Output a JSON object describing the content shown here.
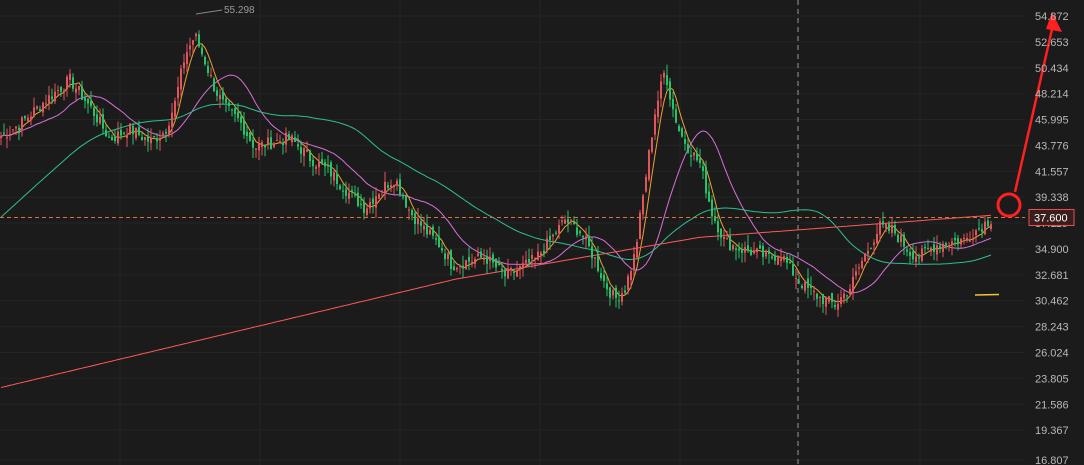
{
  "chart_data": {
    "type": "candlestick",
    "y_axis": {
      "ticks": [
        "54.872",
        "52.653",
        "50.434",
        "48.214",
        "45.995",
        "43.776",
        "41.557",
        "39.338",
        "37.119",
        "34.900",
        "32.681",
        "30.462",
        "28.243",
        "26.024",
        "23.805",
        "21.586",
        "19.367",
        "16.807"
      ],
      "range": [
        16.807,
        56.2
      ]
    },
    "current_price": {
      "label": "37.600",
      "value": 37.6
    },
    "peak_label": {
      "text": "55.298",
      "value": 55.298
    },
    "grid": true,
    "colors": {
      "background": "#1b1b1b",
      "up": "#e0565c",
      "down": "#23c56b",
      "ma_short": "#f0a030",
      "ma_mid": "#d870d8",
      "ma_long": "#2fbf8f",
      "ma_longest": "#ff5a5a",
      "annotation": "#ff2020",
      "price_tag": "#e85050"
    },
    "anchors": [
      [
        0,
        44.5
      ],
      [
        20,
        45.6
      ],
      [
        45,
        47.6
      ],
      [
        70,
        49.4
      ],
      [
        90,
        47.1
      ],
      [
        110,
        44.3
      ],
      [
        130,
        45.2
      ],
      [
        150,
        44.1
      ],
      [
        165,
        45.0
      ],
      [
        175,
        47.4
      ],
      [
        185,
        51.5
      ],
      [
        195,
        53.2
      ],
      [
        205,
        51.0
      ],
      [
        215,
        48.6
      ],
      [
        225,
        47.0
      ],
      [
        240,
        45.8
      ],
      [
        255,
        43.6
      ],
      [
        270,
        44.0
      ],
      [
        290,
        44.4
      ],
      [
        310,
        42.7
      ],
      [
        330,
        41.5
      ],
      [
        350,
        39.6
      ],
      [
        365,
        38.4
      ],
      [
        380,
        40.0
      ],
      [
        395,
        41.0
      ],
      [
        410,
        38.1
      ],
      [
        425,
        36.5
      ],
      [
        440,
        35.2
      ],
      [
        452,
        33.5
      ],
      [
        465,
        33.8
      ],
      [
        485,
        34.2
      ],
      [
        505,
        32.6
      ],
      [
        520,
        33.2
      ],
      [
        535,
        34.0
      ],
      [
        550,
        35.6
      ],
      [
        565,
        37.4
      ],
      [
        580,
        36.4
      ],
      [
        595,
        34.0
      ],
      [
        605,
        31.9
      ],
      [
        615,
        30.6
      ],
      [
        625,
        31.5
      ],
      [
        635,
        34.5
      ],
      [
        645,
        40.6
      ],
      [
        655,
        46.6
      ],
      [
        665,
        50.3
      ],
      [
        672,
        47.2
      ],
      [
        680,
        44.8
      ],
      [
        690,
        43.4
      ],
      [
        700,
        42.2
      ],
      [
        712,
        38.0
      ],
      [
        725,
        35.5
      ],
      [
        740,
        34.9
      ],
      [
        755,
        34.6
      ],
      [
        770,
        34.1
      ],
      [
        780,
        34.6
      ],
      [
        790,
        33.2
      ],
      [
        805,
        31.6
      ],
      [
        820,
        30.7
      ],
      [
        835,
        30.1
      ],
      [
        850,
        31.6
      ],
      [
        865,
        34.4
      ],
      [
        880,
        36.8
      ],
      [
        895,
        36.3
      ],
      [
        910,
        34.6
      ],
      [
        920,
        34.3
      ],
      [
        935,
        35.2
      ],
      [
        950,
        35.5
      ],
      [
        965,
        35.7
      ],
      [
        980,
        36.8
      ],
      [
        993,
        37.6
      ]
    ],
    "moving_averages": [
      {
        "name": "ma_short",
        "period": 5
      },
      {
        "name": "ma_mid",
        "period": 20
      },
      {
        "name": "ma_long",
        "period": 60
      },
      {
        "name": "ma_longest",
        "period": 250
      }
    ]
  }
}
